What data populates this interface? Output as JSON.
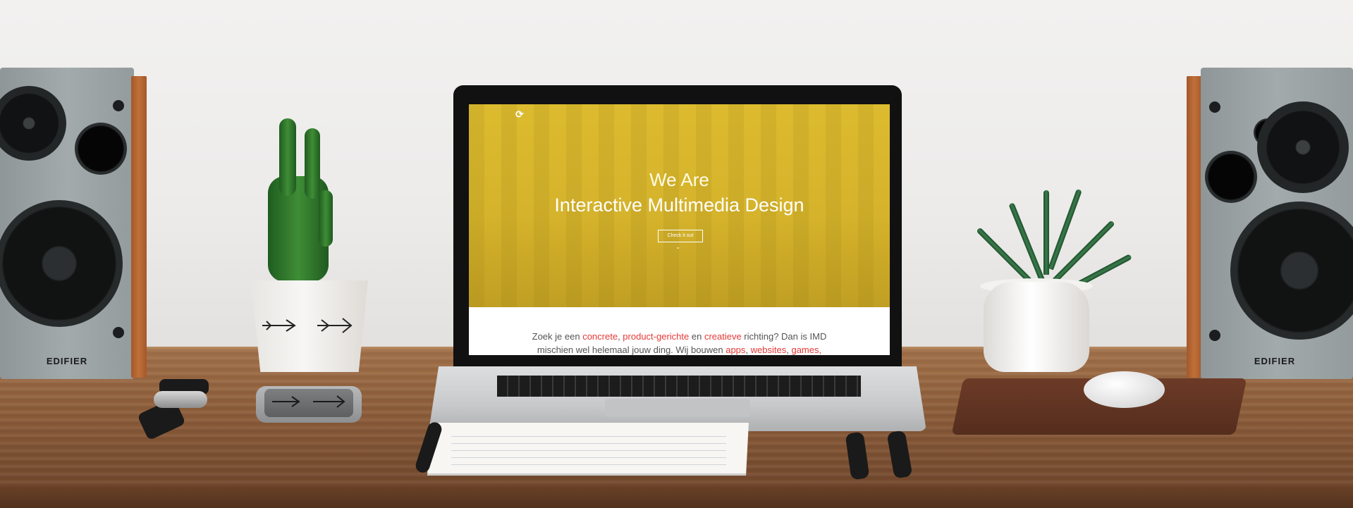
{
  "scene": {
    "speaker_brand": "EDIFIER"
  },
  "website": {
    "logo_icon": "imd-logo-icon",
    "hero_line1": "We Are",
    "hero_line2": "Interactive Multimedia Design",
    "hero_button": "Check it out",
    "hero_arrow": "⌄",
    "intro_part1": "Zoek je een ",
    "intro_link1": "concrete",
    "intro_sep1": ", ",
    "intro_link2": "product-gerichte",
    "intro_part2": " en ",
    "intro_link3": "creatieve",
    "intro_part3": " richting? Dan is IMD",
    "intro_part4": "mischien wel helemaal jouw ding. Wij bouwen ",
    "intro_link4": "apps",
    "intro_sep2": ", ",
    "intro_link5": "websites",
    "intro_sep3": ", ",
    "intro_link6": "games",
    "intro_sep4": ","
  }
}
